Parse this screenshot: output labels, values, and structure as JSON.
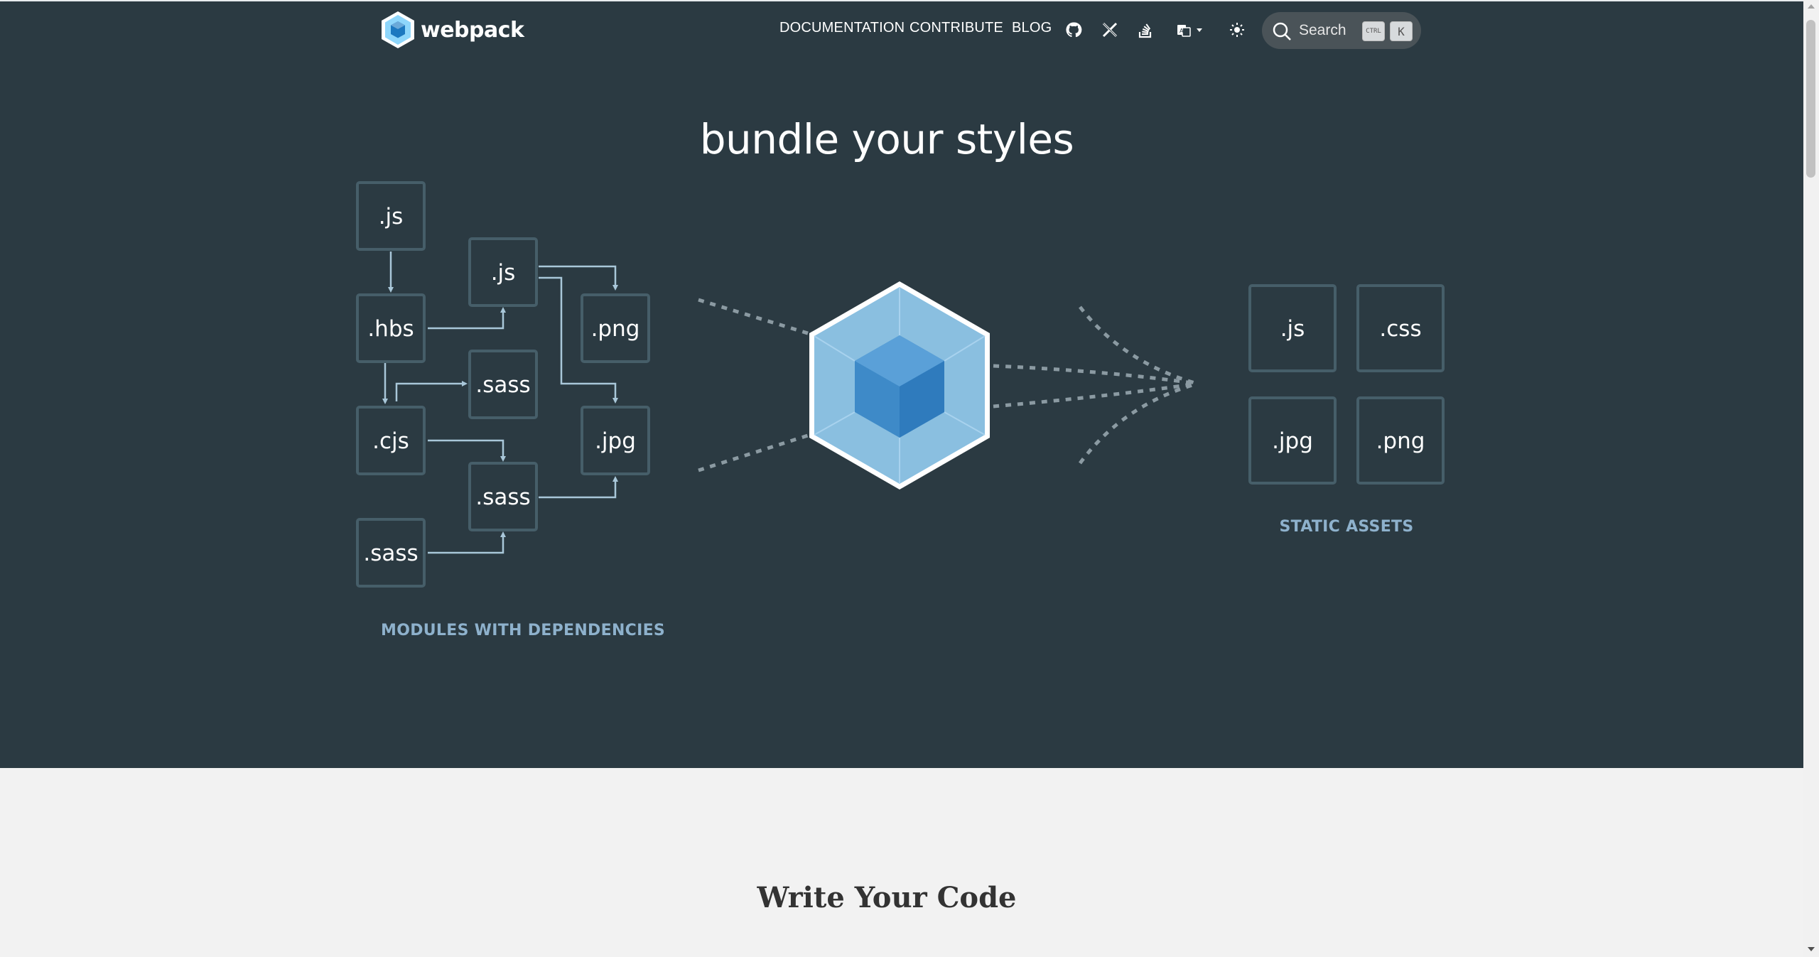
{
  "header": {
    "logo_text": "webpack",
    "nav": {
      "documentation": "DOCUMENTATION",
      "contribute": "CONTRIBUTE",
      "blog": "BLOG"
    },
    "icons": [
      "github-icon",
      "x-icon",
      "stackoverflow-icon",
      "language-icon",
      "theme-toggle-icon"
    ],
    "search": {
      "label": "Search",
      "key1": "CTRL",
      "key2": "K"
    }
  },
  "hero": {
    "title": "bundle your styles",
    "modules_label": "MODULES WITH DEPENDENCIES",
    "assets_label": "STATIC ASSETS",
    "modules": {
      "m1": ".js",
      "m2": ".hbs",
      "m3": ".cjs",
      "m4": ".sass",
      "m5": ".js",
      "m6": ".sass",
      "m7": ".sass",
      "m8": ".png",
      "m9": ".jpg"
    },
    "assets": {
      "a1": ".js",
      "a2": ".css",
      "a3": ".jpg",
      "a4": ".png"
    }
  },
  "section": {
    "title": "Write Your Code"
  },
  "colors": {
    "hero_bg": "#2b3a42",
    "box_border": "#465e69",
    "label": "#8eb1cc",
    "cube_light": "#8ed6fb",
    "cube_dark": "#1c78c0"
  }
}
